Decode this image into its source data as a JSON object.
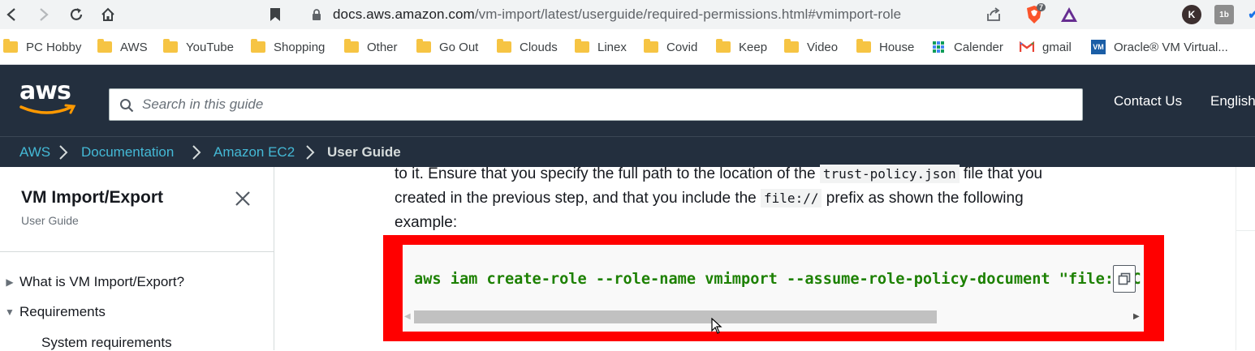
{
  "browser": {
    "url_host": "docs.aws.amazon.com",
    "url_path": "/vm-import/latest/userguide/required-permissions.html#vmimport-role",
    "extension_badge": "7",
    "profile_initial": "K"
  },
  "bookmarks": [
    {
      "label": "PC Hobby",
      "icon": "folder-icon"
    },
    {
      "label": "AWS",
      "icon": "folder-icon"
    },
    {
      "label": "YouTube",
      "icon": "folder-icon"
    },
    {
      "label": "Shopping",
      "icon": "folder-icon"
    },
    {
      "label": "Other",
      "icon": "folder-icon"
    },
    {
      "label": "Go Out",
      "icon": "folder-icon"
    },
    {
      "label": "Clouds",
      "icon": "folder-icon"
    },
    {
      "label": "Linex",
      "icon": "folder-icon"
    },
    {
      "label": "Covid",
      "icon": "folder-icon"
    },
    {
      "label": "Keep",
      "icon": "folder-icon"
    },
    {
      "label": "Video",
      "icon": "folder-icon"
    },
    {
      "label": "House",
      "icon": "folder-icon"
    },
    {
      "label": "Calender",
      "icon": "calendar-icon"
    },
    {
      "label": "gmail",
      "icon": "gmail-icon"
    },
    {
      "label": "Oracle® VM Virtual...",
      "icon": "virtualbox-icon"
    }
  ],
  "header": {
    "logo_text": "aws",
    "search_placeholder": "Search in this guide",
    "contact_label": "Contact Us",
    "language_label": "English"
  },
  "breadcrumb": [
    "AWS",
    "Documentation",
    "Amazon EC2",
    "User Guide"
  ],
  "sidebar": {
    "title": "VM Import/Export",
    "subtitle": "User Guide",
    "items": [
      {
        "label": "What is VM Import/Export?",
        "expanded": false
      },
      {
        "label": "Requirements",
        "expanded": true
      },
      {
        "label": "System requirements",
        "child": true
      }
    ]
  },
  "content": {
    "line1_pre": "to it. Ensure that you specify the full path to the location of the ",
    "line1_code": "trust-policy.json",
    "line1_post": " file that you",
    "line2_pre": "created in the previous step, and that you include the ",
    "line2_code": "file://",
    "line2_post": " prefix as shown the following",
    "line3": "example:",
    "code": "aws iam create-role --role-name vmimport --assume-role-policy-document \"file://C:\\import\\trust-policy.json\"",
    "highlight_color": "#ff0000",
    "code_color": "#1d8102"
  },
  "colors": {
    "aws_dark": "#232f3e",
    "link": "#44b9d6",
    "aws_orange": "#ff9900"
  }
}
